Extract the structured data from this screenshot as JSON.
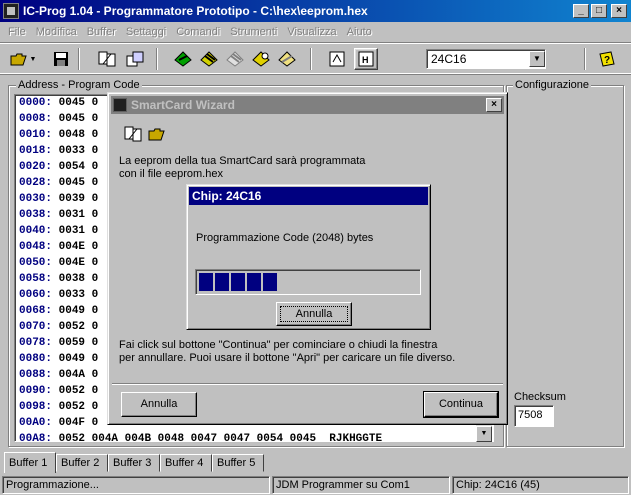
{
  "window": {
    "title": "IC-Prog 1.04 - Programmatore Prototipo - C:\\hex\\eeprom.hex",
    "minimize": "_",
    "maximize": "□",
    "close": "×"
  },
  "menu": [
    "File",
    "Modifica",
    "Buffer",
    "Settaggi",
    "Comandi",
    "Strumenti",
    "Visualizza",
    "Aiuto"
  ],
  "toolbar": {
    "chip_select": "24C16",
    "dropdown_arrow": "▼"
  },
  "address_panel": {
    "legend": "Address - Program Code",
    "rows": [
      {
        "addr": "0000:",
        "code": "0045 0"
      },
      {
        "addr": "0008:",
        "code": "0045 0"
      },
      {
        "addr": "0010:",
        "code": "0048 0"
      },
      {
        "addr": "0018:",
        "code": "0033 0"
      },
      {
        "addr": "0020:",
        "code": "0054 0"
      },
      {
        "addr": "0028:",
        "code": "0045 0"
      },
      {
        "addr": "0030:",
        "code": "0039 0"
      },
      {
        "addr": "0038:",
        "code": "0031 0"
      },
      {
        "addr": "0040:",
        "code": "0031 0"
      },
      {
        "addr": "0048:",
        "code": "004E 0"
      },
      {
        "addr": "0050:",
        "code": "004E 0"
      },
      {
        "addr": "0058:",
        "code": "0038 0"
      },
      {
        "addr": "0060:",
        "code": "0033 0"
      },
      {
        "addr": "0068:",
        "code": "0049 0"
      },
      {
        "addr": "0070:",
        "code": "0052 0"
      },
      {
        "addr": "0078:",
        "code": "0059 0"
      },
      {
        "addr": "0080:",
        "code": "0049 0"
      },
      {
        "addr": "0088:",
        "code": "004A 0"
      },
      {
        "addr": "0090:",
        "code": "0052 0"
      },
      {
        "addr": "0098:",
        "code": "0052 0"
      },
      {
        "addr": "00A0:",
        "code": "004F 0"
      },
      {
        "addr": "00A8:",
        "code": "0052 004A 004B 0048 0047 0047 0054 0045  RJKHGGTE"
      }
    ]
  },
  "config_panel": {
    "legend": "Configurazione",
    "checksum_label": "Checksum",
    "checksum_value": "7508"
  },
  "tabs": [
    "Buffer 1",
    "Buffer 2",
    "Buffer 3",
    "Buffer 4",
    "Buffer 5"
  ],
  "statusbar": {
    "left": "Programmazione...",
    "middle": "JDM Programmer su Com1",
    "right": "Chip: 24C16  (45)"
  },
  "wizard": {
    "title": "SmartCard Wizard",
    "close": "×",
    "intro_line1": "La eeprom della tua SmartCard sarà programmata",
    "intro_line2": "con il file eeprom.hex",
    "hint_line1": "Fai click sul bottone \"Continua\" per cominciare o chiudi la finestra",
    "hint_line2": "per annullare. Puoi usare il bottone \"Apri\" per caricare un file diverso.",
    "cancel_label": "Annulla",
    "continue_label": "Continua"
  },
  "chip_dialog": {
    "title": "Chip: 24C16",
    "message": "Programmazione Code (2048) bytes",
    "cancel_label": "Annulla",
    "progress_fraction": 0.4
  }
}
